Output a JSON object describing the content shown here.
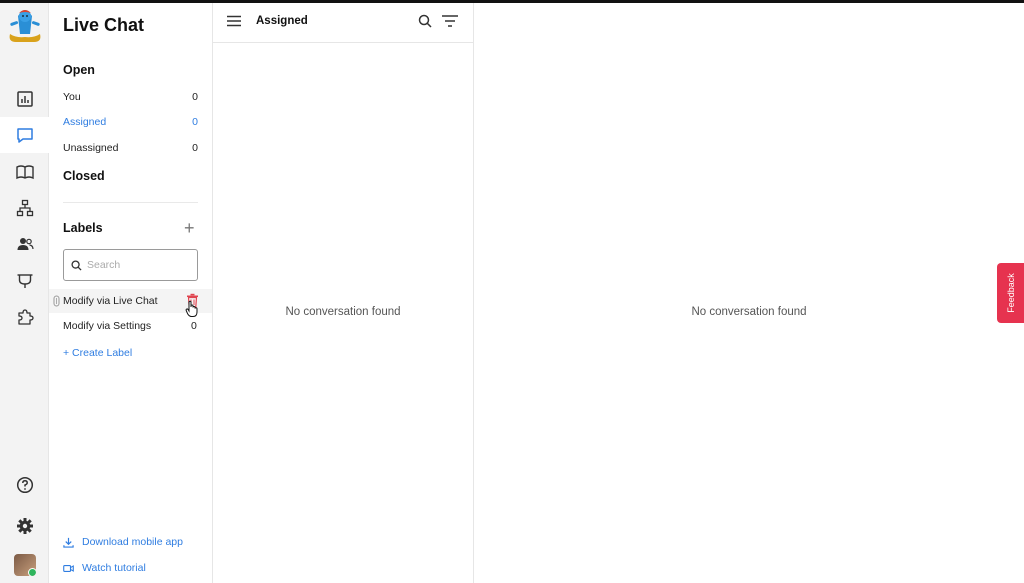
{
  "app": {
    "title": "Live Chat"
  },
  "sidebar": {
    "open_heading": "Open",
    "open_items": [
      {
        "label": "You",
        "count": "0"
      },
      {
        "label": "Assigned",
        "count": "0"
      },
      {
        "label": "Unassigned",
        "count": "0"
      }
    ],
    "closed_heading": "Closed",
    "labels_heading": "Labels",
    "add_label_symbol": "+",
    "search_placeholder": "Search",
    "labels": [
      {
        "label": "Modify via Live Chat"
      },
      {
        "label": "Modify via Settings",
        "count": "0"
      }
    ],
    "create_label": "+ Create Label",
    "download_app": "Download mobile app",
    "watch_tutorial": "Watch tutorial"
  },
  "conversations": {
    "header": "Assigned",
    "empty_text": "No conversation found"
  },
  "detail": {
    "empty_text": "No conversation found"
  },
  "feedback": {
    "label": "Feedback"
  },
  "colors": {
    "accent": "#2f7de1",
    "feedback": "#e6334f",
    "trash": "#e0444f"
  }
}
